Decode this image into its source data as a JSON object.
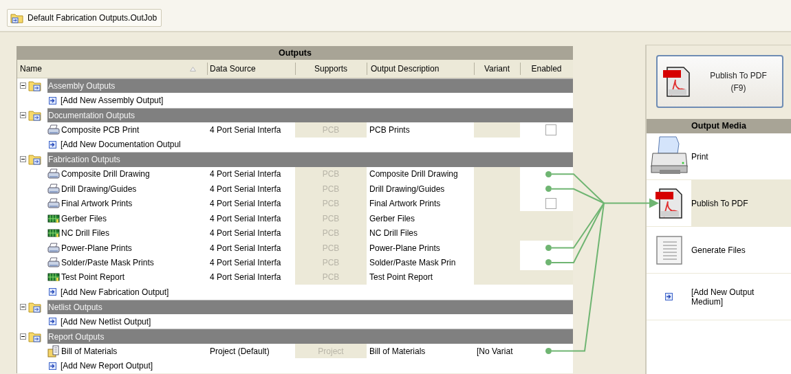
{
  "document_tab": {
    "label": "Default Fabrication Outputs.OutJob"
  },
  "outputs": {
    "title": "Outputs",
    "columns": [
      {
        "label": "Name",
        "sorted": true
      },
      {
        "label": "Data Source",
        "sorted": false
      },
      {
        "label": "Supports",
        "sorted": false
      },
      {
        "label": "Output Description",
        "sorted": false
      },
      {
        "label": "Variant",
        "sorted": false
      },
      {
        "label": "Enabled",
        "sorted": false
      }
    ],
    "groups": [
      {
        "label": "Assembly Outputs",
        "expanded": true,
        "rows": [
          {
            "kind": "add",
            "label": "[Add New Assembly Output]"
          }
        ]
      },
      {
        "label": "Documentation Outputs",
        "expanded": true,
        "rows": [
          {
            "kind": "printer",
            "label": "Composite PCB Print",
            "data_source": "4 Port Serial Interfa",
            "supports": "PCB",
            "description": "PCB Prints",
            "enabled": false
          },
          {
            "kind": "add",
            "label": "[Add New Documentation Outpul"
          }
        ]
      },
      {
        "label": "Fabrication Outputs",
        "expanded": true,
        "rows": [
          {
            "kind": "printer",
            "label": "Composite Drill Drawing",
            "data_source": "4 Port Serial Interfa",
            "supports": "PCB",
            "description": "Composite Drill Drawing",
            "enabled": true
          },
          {
            "kind": "printer",
            "label": "Drill Drawing/Guides",
            "data_source": "4 Port Serial Interfa",
            "supports": "PCB",
            "description": "Drill Drawing/Guides",
            "enabled": true
          },
          {
            "kind": "printer",
            "label": "Final Artwork Prints",
            "data_source": "4 Port Serial Interfa",
            "supports": "PCB",
            "description": "Final Artwork Prints",
            "enabled": false
          },
          {
            "kind": "board",
            "label": "Gerber Files",
            "data_source": "4 Port Serial Interfa",
            "supports": "PCB",
            "description": "Gerber Files"
          },
          {
            "kind": "board",
            "label": "NC Drill Files",
            "data_source": "4 Port Serial Interfa",
            "supports": "PCB",
            "description": "NC Drill Files"
          },
          {
            "kind": "printer",
            "label": "Power-Plane Prints",
            "data_source": "4 Port Serial Interfa",
            "supports": "PCB",
            "description": "Power-Plane Prints",
            "enabled": true
          },
          {
            "kind": "printer",
            "label": "Solder/Paste Mask Prints",
            "data_source": "4 Port Serial Interfa",
            "supports": "PCB",
            "description": "Solder/Paste Mask Prin",
            "enabled": true
          },
          {
            "kind": "board",
            "label": "Test Point Report",
            "data_source": "4 Port Serial Interfa",
            "supports": "PCB",
            "description": "Test Point Report"
          },
          {
            "kind": "add",
            "label": "[Add New Fabrication Output]"
          }
        ]
      },
      {
        "label": "Netlist Outputs",
        "expanded": true,
        "rows": [
          {
            "kind": "add",
            "label": "[Add New Netlist Output]"
          }
        ]
      },
      {
        "label": "Report Outputs",
        "expanded": true,
        "rows": [
          {
            "kind": "report",
            "label": "Bill of Materials",
            "data_source": "Project (Default)",
            "supports": "Project",
            "description": "Bill of Materials",
            "variant": "[No Variat",
            "enabled": true
          },
          {
            "kind": "add",
            "label": "[Add New Report Output]"
          }
        ]
      }
    ]
  },
  "publish_button": {
    "label_lines": [
      "Publish To PDF",
      "(F9)"
    ]
  },
  "output_media": {
    "title": "Output Media",
    "items": [
      {
        "kind": "printer",
        "label": "Print",
        "selected": false
      },
      {
        "kind": "pdf",
        "label": "Publish To PDF",
        "selected": true
      },
      {
        "kind": "files",
        "label": "Generate Files",
        "selected": false
      },
      {
        "kind": "add",
        "label": "[Add New Output Medium]",
        "selected": false
      }
    ]
  }
}
